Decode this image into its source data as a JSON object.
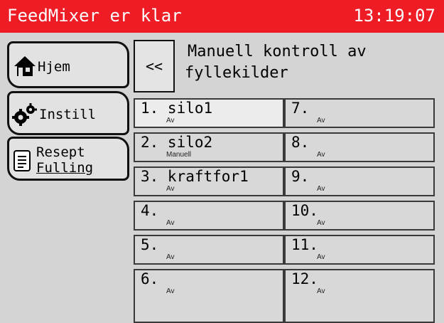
{
  "header": {
    "title": "FeedMixer er klar",
    "time": "13:19:07"
  },
  "sidebar": {
    "items": [
      {
        "label": "Hjem",
        "icon": "house-icon"
      },
      {
        "label": "Instill",
        "icon": "gears-icon"
      },
      {
        "label_line1": "Resept",
        "label_line2": "Fulling",
        "icon": "document-icon"
      }
    ]
  },
  "back": {
    "label": "<<"
  },
  "page_title": {
    "line1": "Manuell kontroll av",
    "line2": "fyllekilder"
  },
  "sources": [
    {
      "name": "1. silo1",
      "state": "Av"
    },
    {
      "name": "2. silo2",
      "state": "Manuell"
    },
    {
      "name": "3. kraftfor1",
      "state": "Av"
    },
    {
      "name": "4.",
      "state": "Av"
    },
    {
      "name": "5.",
      "state": "Av"
    },
    {
      "name": "6.",
      "state": "Av"
    },
    {
      "name": "7.",
      "state": "Av"
    },
    {
      "name": "8.",
      "state": "Av"
    },
    {
      "name": "9.",
      "state": "Av"
    },
    {
      "name": "10.",
      "state": "Av"
    },
    {
      "name": "11.",
      "state": "Av"
    },
    {
      "name": "12.",
      "state": "Av"
    }
  ],
  "colors": {
    "titlebar": "#ee1c25",
    "background": "#d4d4d4"
  }
}
